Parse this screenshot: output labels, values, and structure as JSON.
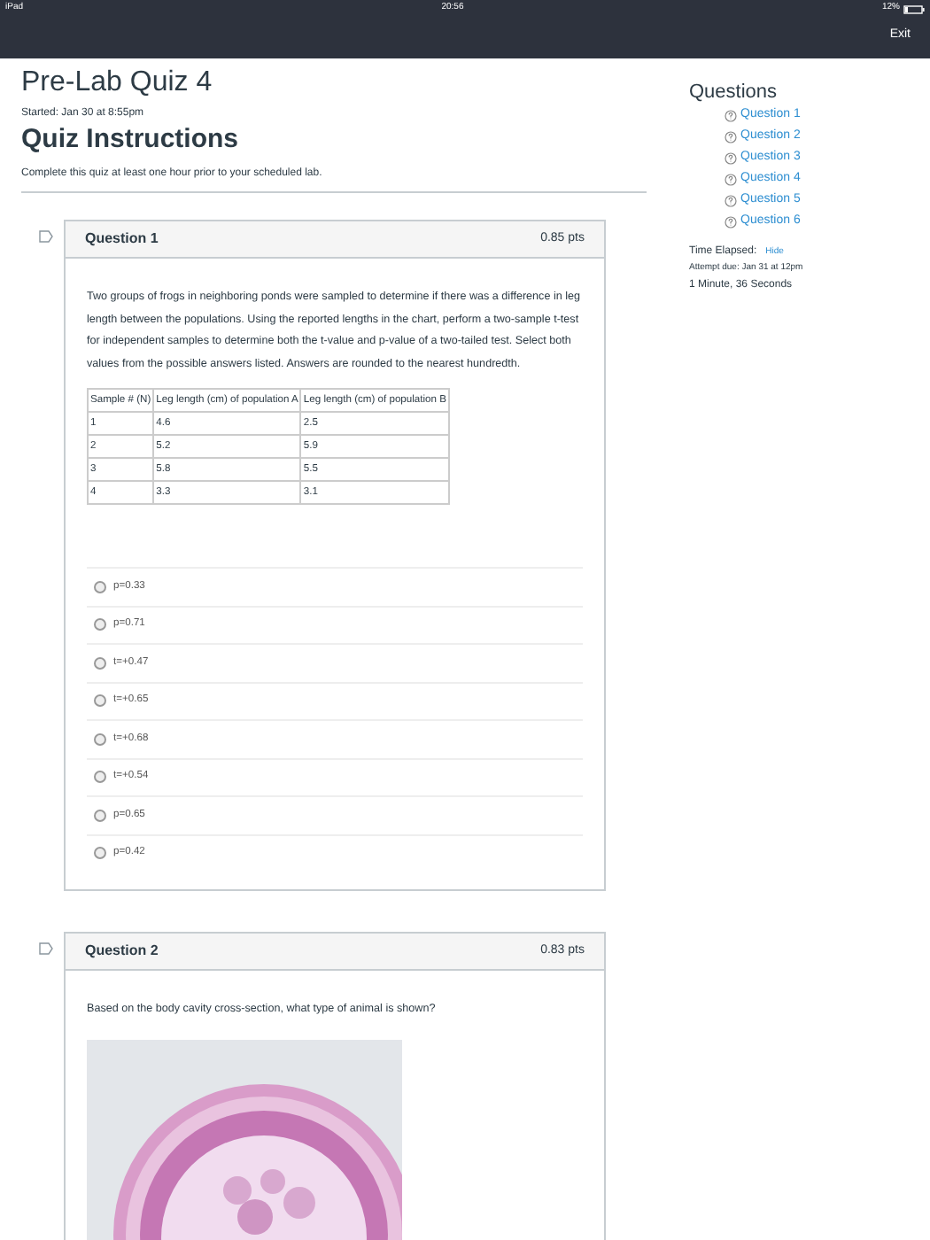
{
  "status_bar": {
    "device": "iPad",
    "time": "20:56",
    "battery": "12%"
  },
  "header": {
    "exit": "Exit"
  },
  "quiz": {
    "title": "Pre-Lab Quiz 4",
    "started": "Started: Jan 30 at 8:55pm",
    "instructions_heading": "Quiz Instructions",
    "instructions": "Complete this quiz at least one hour prior to your scheduled lab."
  },
  "sidebar": {
    "heading": "Questions",
    "items": [
      "Question 1",
      "Question 2",
      "Question 3",
      "Question 4",
      "Question 5",
      "Question 6"
    ],
    "timer": {
      "label": "Time Elapsed:",
      "hide": "Hide",
      "attempt_due": "Attempt due: Jan 31 at 12pm",
      "elapsed": "1 Minute, 36 Seconds"
    }
  },
  "questions": [
    {
      "title": "Question 1",
      "points": "0.85 pts",
      "text": "Two groups of frogs in neighboring ponds were sampled to determine if there was a difference in leg length between the populations.  Using the reported lengths in the chart, perform a two-sample t-test for independent samples to determine both the t-value and p-value of a two-tailed test.  Select both values from the possible answers listed.  Answers are rounded to the nearest hundredth.",
      "table": {
        "columns": [
          "Sample # (N)",
          "Leg length (cm) of population A",
          "Leg length (cm) of population B"
        ],
        "rows": [
          [
            "1",
            "4.6",
            "2.5"
          ],
          [
            "2",
            "5.2",
            "5.9"
          ],
          [
            "3",
            "5.8",
            "5.5"
          ],
          [
            "4",
            "3.3",
            "3.1"
          ]
        ]
      },
      "answers": [
        {
          "label": "p=0.33",
          "selected": false
        },
        {
          "label": "p=0.71",
          "selected": false
        },
        {
          "label": "t=+0.47",
          "selected": false
        },
        {
          "label": "t=+0.65",
          "selected": false
        },
        {
          "label": "t=+0.68",
          "selected": false
        },
        {
          "label": "t=+0.54",
          "selected": false
        },
        {
          "label": "p=0.65",
          "selected": false
        },
        {
          "label": "p=0.42",
          "selected": false
        }
      ]
    },
    {
      "title": "Question 2",
      "points": "0.83 pts",
      "text": "Based on the body cavity cross-section, what type of animal is shown?",
      "kind": "picture"
    }
  ]
}
